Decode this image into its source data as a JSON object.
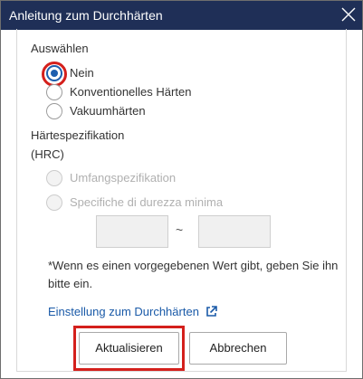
{
  "dialog": {
    "title": "Anleitung zum Durchhärten"
  },
  "selection": {
    "heading": "Auswählen",
    "options": [
      {
        "label": "Nein",
        "selected": true,
        "disabled": false
      },
      {
        "label": "Konventionelles Härten",
        "selected": false,
        "disabled": false
      },
      {
        "label": "Vakuumhärten",
        "selected": false,
        "disabled": false
      }
    ]
  },
  "hardness": {
    "heading": "Härtespezifikation",
    "unit": "(HRC)",
    "options": [
      {
        "label": "Umfangspezifikation",
        "selected": false,
        "disabled": true
      },
      {
        "label": "Specifiche di durezza minima",
        "selected": false,
        "disabled": true
      }
    ],
    "range_separator": "~",
    "min_value": "",
    "max_value": ""
  },
  "note": "*Wenn es einen vorgegebenen Wert gibt, geben Sie ihn bitte ein.",
  "link": {
    "label": "Einstellung zum Durchhärten",
    "icon": "external-link-icon"
  },
  "buttons": {
    "update": "Aktualisieren",
    "cancel": "Abbrechen"
  },
  "colors": {
    "titlebar": "#1f2f57",
    "accent": "#1e5fae",
    "highlight": "#d4201c",
    "link": "#1a5aa8"
  }
}
